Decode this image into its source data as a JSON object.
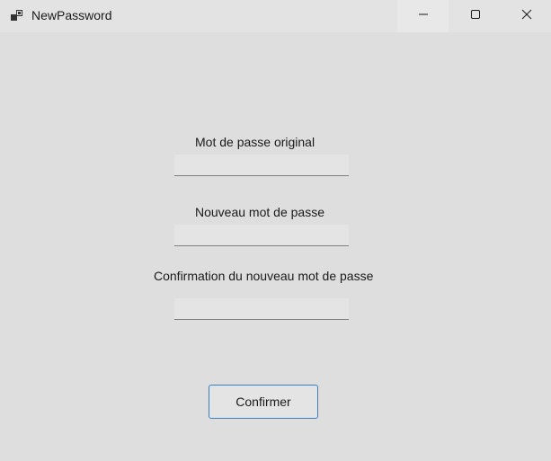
{
  "window": {
    "title": "NewPassword",
    "icon": "app-window-icon",
    "controls": {
      "minimize_icon": "minimize-icon",
      "maximize_icon": "maximize-icon",
      "close_icon": "close-icon"
    }
  },
  "form": {
    "original_password_label": "Mot de passe original",
    "original_password_value": "",
    "new_password_label": "Nouveau mot de passe",
    "new_password_value": "",
    "confirm_password_label": "Confirmation du nouveau mot de passe",
    "confirm_password_value": "",
    "confirm_button_label": "Confirmer"
  },
  "colors": {
    "background": "#dedede",
    "accent_border": "#3a7fc4"
  }
}
